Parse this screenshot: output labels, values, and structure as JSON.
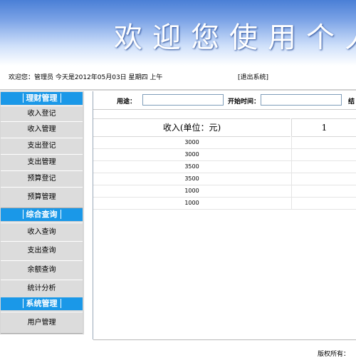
{
  "banner": {
    "title": "欢迎您使用个人理"
  },
  "status": {
    "greeting": "欢迎您：管理员   今天是2012年05月03日   星期四   上午",
    "logout": "[退出系统]"
  },
  "sidebar": {
    "categories": [
      {
        "title": "理财管理",
        "items": [
          "收入登记",
          "收入管理",
          "支出登记",
          "支出管理",
          "预算登记",
          "预算管理"
        ]
      },
      {
        "title": "综合查询",
        "items": [
          "收入查询",
          "支出查询",
          "余额查询",
          "统计分析"
        ]
      },
      {
        "title": "系统管理",
        "items": [
          "用户管理"
        ]
      }
    ]
  },
  "search": {
    "purpose_label": "用途：",
    "start_label": "开始时间：",
    "end_label": "结"
  },
  "table": {
    "headers": [
      "收入(单位：元)",
      "1"
    ],
    "rows": [
      [
        "3000"
      ],
      [
        "3000"
      ],
      [
        "3500"
      ],
      [
        "3500"
      ],
      [
        "1000"
      ],
      [
        "1000"
      ]
    ]
  },
  "footer": {
    "text": "版权所有："
  }
}
